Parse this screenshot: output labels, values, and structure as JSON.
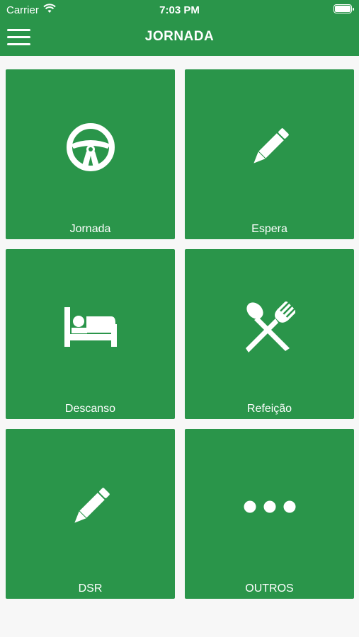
{
  "status": {
    "carrier": "Carrier",
    "time": "7:03 PM"
  },
  "header": {
    "title": "JORNADA"
  },
  "tiles": [
    {
      "label": "Jornada",
      "icon": "steering-wheel-icon"
    },
    {
      "label": "Espera",
      "icon": "pencil-icon"
    },
    {
      "label": "Descanso",
      "icon": "bed-icon"
    },
    {
      "label": "Refeição",
      "icon": "utensils-icon"
    },
    {
      "label": "DSR",
      "icon": "pencil-icon"
    },
    {
      "label": "OUTROS",
      "icon": "ellipsis-icon"
    }
  ],
  "colors": {
    "brand": "#2a954a",
    "background": "#f7f7f7",
    "foreground": "#ffffff"
  }
}
